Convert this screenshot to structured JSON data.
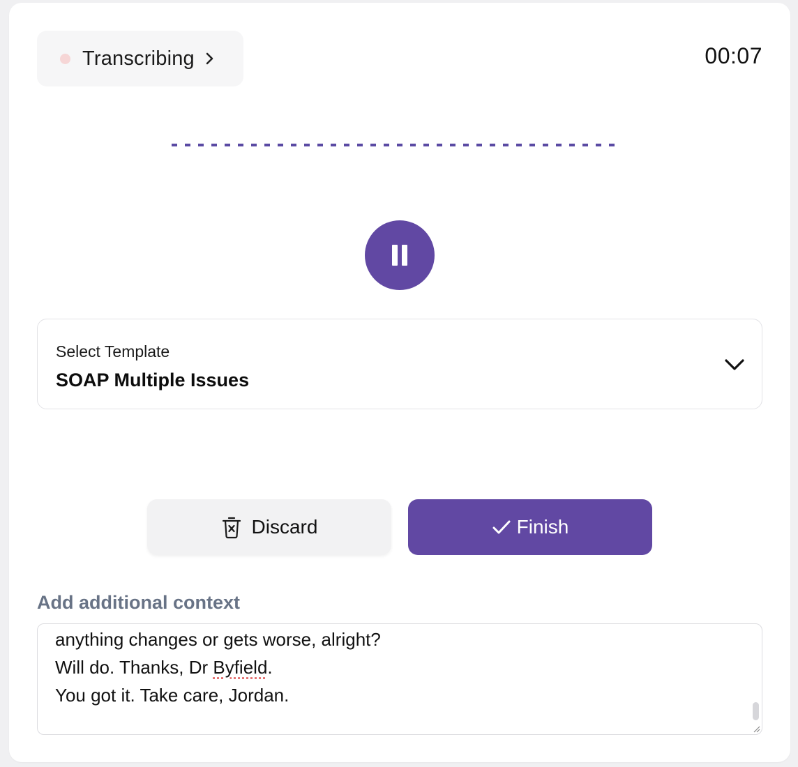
{
  "status": {
    "label": "Transcribing",
    "dot_color": "#f6d6d6"
  },
  "timer": "00:07",
  "template": {
    "label": "Select Template",
    "value": "SOAP Multiple Issues"
  },
  "actions": {
    "discard_label": "Discard",
    "finish_label": "Finish"
  },
  "context": {
    "label": "Add additional context",
    "lines": [
      "anything changes or gets worse, alright?",
      "Will do. Thanks, Dr ",
      "Byfield",
      ".",
      "You got it. Take care, Jordan."
    ]
  },
  "colors": {
    "accent": "#6148a3",
    "context_label": "#687386",
    "surface": "#f6f6f7"
  },
  "icons": {
    "status": "record-dot-icon",
    "status_expand": "chevron-right-icon",
    "pause": "pause-icon",
    "template_expand": "chevron-down-icon",
    "discard": "trash-icon",
    "finish": "check-icon"
  }
}
